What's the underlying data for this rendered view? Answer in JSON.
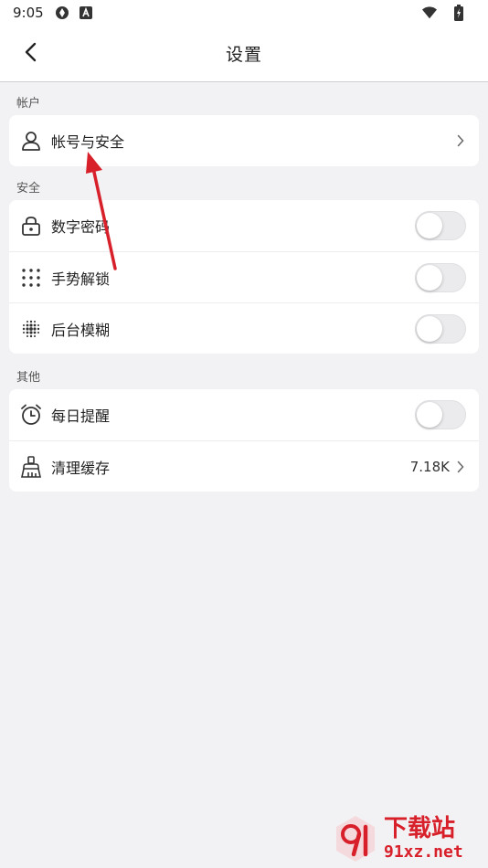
{
  "status_bar": {
    "time": "9:05",
    "icons": [
      "sync-icon",
      "accessibility-a-icon",
      "wifi-icon",
      "battery-charging-icon"
    ]
  },
  "app_bar": {
    "title": "设置",
    "back_icon": "chevron-left-icon"
  },
  "sections": {
    "account": {
      "label": "帐户",
      "items": [
        {
          "label": "帐号与安全",
          "icon": "user-icon",
          "control": "chevron"
        }
      ]
    },
    "security": {
      "label": "安全",
      "items": [
        {
          "label": "数字密码",
          "icon": "lock-icon",
          "control": "toggle",
          "on": false
        },
        {
          "label": "手势解锁",
          "icon": "dot-grid-icon",
          "control": "toggle",
          "on": false
        },
        {
          "label": "后台模糊",
          "icon": "blur-icon",
          "control": "toggle",
          "on": false
        }
      ]
    },
    "other": {
      "label": "其他",
      "items": [
        {
          "label": "每日提醒",
          "icon": "alarm-clock-icon",
          "control": "toggle",
          "on": false
        },
        {
          "label": "清理缓存",
          "icon": "broom-icon",
          "control": "chevron",
          "value": "7.18K"
        }
      ]
    }
  },
  "colors": {
    "background": "#f2f2f4",
    "card": "#ffffff",
    "annotation_arrow": "#d8202b",
    "watermark": "#d8202b"
  },
  "watermark": {
    "title": "下载站",
    "domain": "91xz.net"
  }
}
